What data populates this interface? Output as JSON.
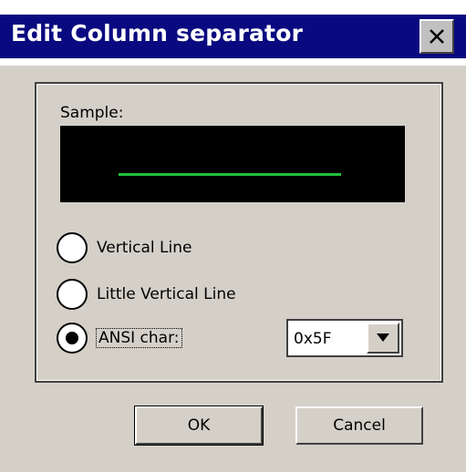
{
  "window": {
    "title": "Edit Column separator",
    "close_icon": "close-icon"
  },
  "sample": {
    "label": "Sample:",
    "background_color": "#000000",
    "line_color": "#1fbf3a"
  },
  "options": [
    {
      "label": "Vertical Line",
      "selected": false
    },
    {
      "label": "Little Vertical Line",
      "selected": false
    },
    {
      "label": "ANSI char:",
      "selected": true
    }
  ],
  "ansi_select": {
    "value": "0x5F",
    "arrow_icon": "chevron-down-icon"
  },
  "buttons": {
    "ok": "OK",
    "cancel": "Cancel"
  },
  "colors": {
    "titlebar": "#0a0a80",
    "dialog_face": "#d4d0c8"
  }
}
